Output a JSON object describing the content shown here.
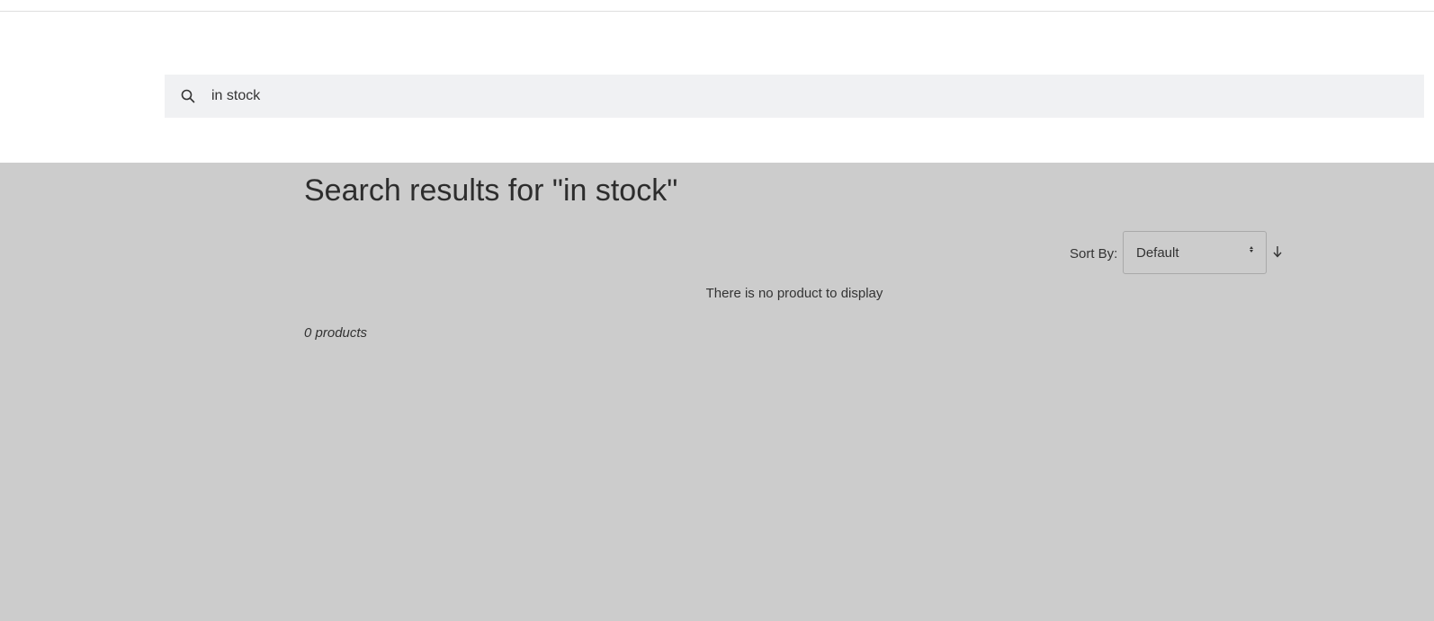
{
  "search": {
    "value": "in stock",
    "icon": "search-icon"
  },
  "results": {
    "title": "Search results for \"in stock\"",
    "empty_message": "There is no product to display",
    "count_text": "0 products"
  },
  "sort": {
    "label": "Sort By:",
    "selected": "Default",
    "direction_icon": "arrow-down-icon"
  },
  "colors": {
    "page_background": "#cccccc",
    "search_background": "#f0f1f3",
    "header_background": "#ffffff"
  }
}
